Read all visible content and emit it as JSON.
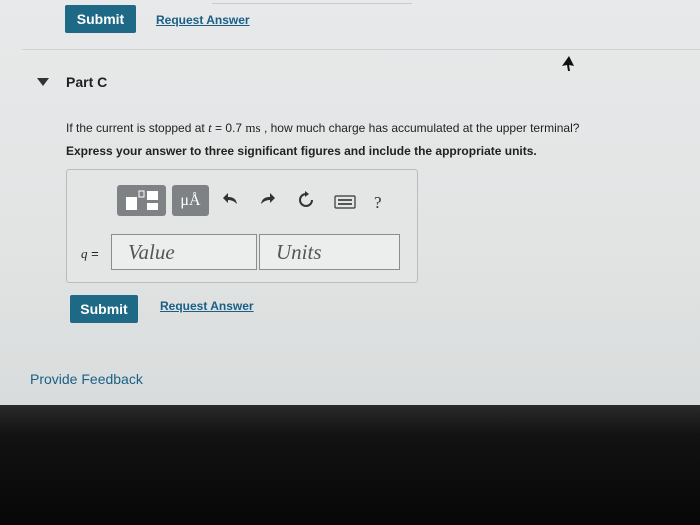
{
  "top": {
    "submit_label": "Submit",
    "request_answer_label": "Request Answer"
  },
  "part": {
    "label": "Part C",
    "question_prefix": "If the current is stopped at",
    "question_var": "t",
    "question_eq": " = 0.7 ",
    "question_unit": "ms",
    "question_suffix": ", how much charge has accumulated at the upper terminal?",
    "instruction": "Express your answer to three significant figures and include the appropriate units."
  },
  "toolbar": {
    "units_symbol": "μÅ",
    "help_symbol": "?",
    "icons": [
      "templates-icon",
      "units-icon",
      "undo-icon",
      "redo-icon",
      "reset-icon",
      "keyboard-icon",
      "help-icon"
    ]
  },
  "answer": {
    "variable": "q",
    "equals": " =",
    "value_placeholder": "Value",
    "units_placeholder": "Units",
    "submit_label": "Submit",
    "request_answer_label": "Request Answer"
  },
  "footer": {
    "feedback_label": "Provide Feedback"
  },
  "colors": {
    "button": "#1e6a86",
    "link": "#1a5f85"
  }
}
